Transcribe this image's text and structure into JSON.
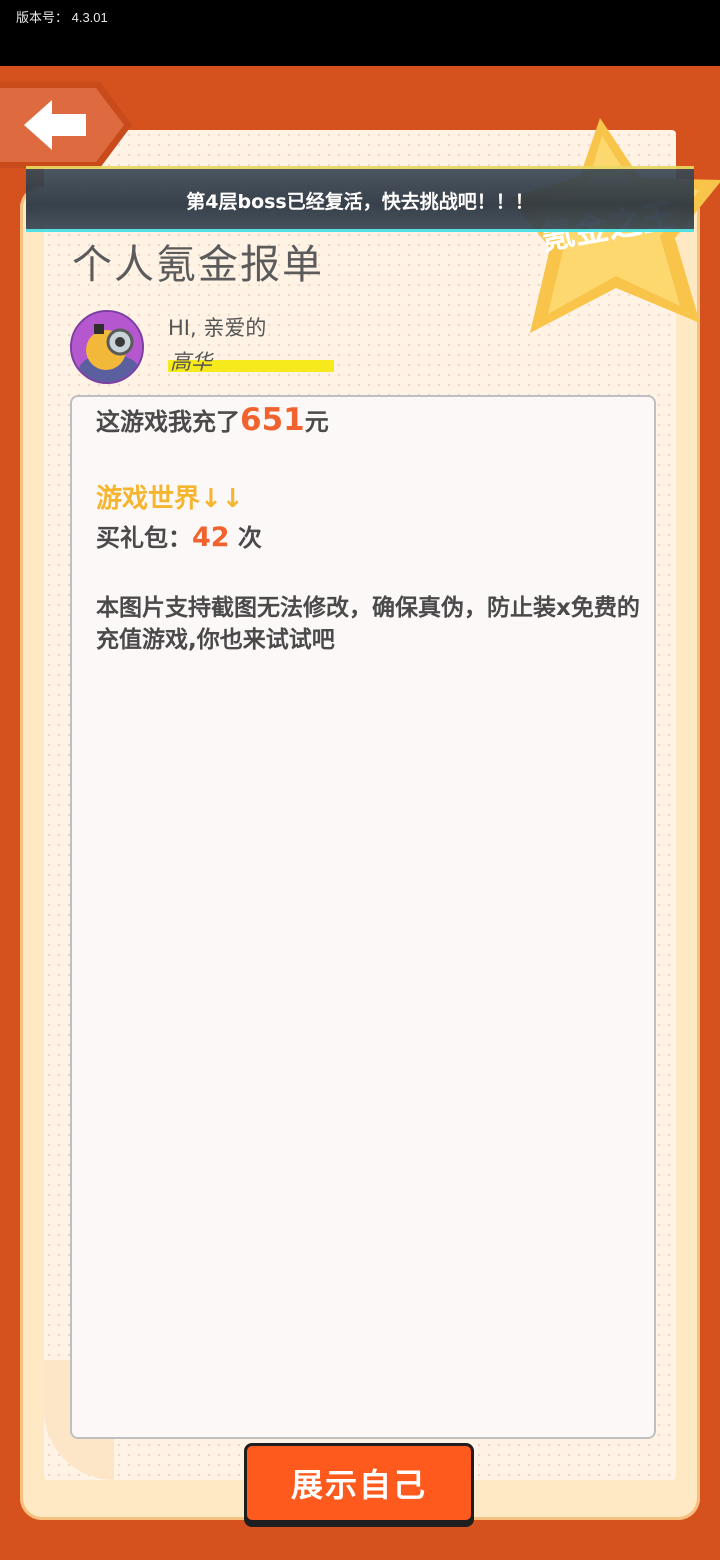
{
  "status_bar": {
    "version_text": "版本号： 4.3.01"
  },
  "notice": {
    "text": "第4层boss已经复活，快去挑战吧！！！"
  },
  "badge": {
    "text": "氪金之王"
  },
  "report": {
    "title": "个人氪金报单",
    "greeting": "HI, 亲爱的",
    "username": "高华",
    "spent_prefix": "这游戏我充了",
    "spent_amount": "651",
    "spent_suffix": "元",
    "world_label": "游戏世界↓↓",
    "gift_prefix": "买礼包：",
    "gift_count": "42",
    "gift_suffix": " 次",
    "description": "本图片支持截图无法修改，确保真伪，防止装x免费的充值游戏,你也来试试吧"
  },
  "cta": {
    "label": "展示自己"
  },
  "colors": {
    "background": "#d5521f",
    "accent": "#f0622e",
    "highlight": "#f6b52e",
    "username_bar": "#f6ea1c",
    "button": "#ff5a1e"
  }
}
